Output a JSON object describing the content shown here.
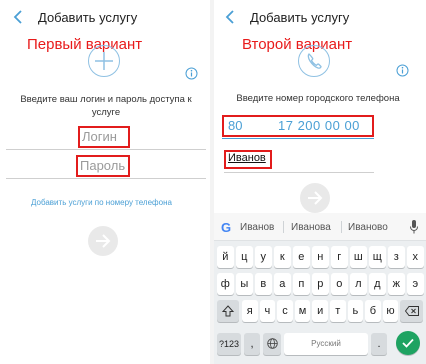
{
  "left": {
    "title": "Добавить услугу",
    "variant_label": "Первый вариант",
    "prompt": "Введите ваш логин и пароль доступа к услуге",
    "login_placeholder": "Логин",
    "password_placeholder": "Пароль",
    "link": "Добавить услуги по номеру телефона"
  },
  "right": {
    "title": "Добавить услугу",
    "variant_label": "Второй вариант",
    "prompt": "Введите номер городского телефона",
    "phone_code": "80",
    "phone_number": "17 200 00 00",
    "name_value": "Иванов"
  },
  "keyboard": {
    "suggestions": [
      "Иванов",
      "Иванова",
      "Иваново"
    ],
    "row1": [
      "й",
      "ц",
      "у",
      "к",
      "е",
      "н",
      "г",
      "ш",
      "щ",
      "з",
      "х"
    ],
    "row2": [
      "ф",
      "ы",
      "в",
      "а",
      "п",
      "р",
      "о",
      "л",
      "д",
      "ж",
      "э"
    ],
    "row3": [
      "я",
      "ч",
      "с",
      "м",
      "и",
      "т",
      "ь",
      "б",
      "ю"
    ],
    "symbols_label": "?123",
    "comma_label": ",",
    "space_label": "Русский",
    "period_label": "."
  },
  "colors": {
    "accent": "#4a9fd5",
    "highlight": "#e21c1c",
    "enter": "#1ea362"
  },
  "icons": [
    "back-arrow-icon",
    "plus-circle-icon",
    "phone-circle-icon",
    "info-icon",
    "arrow-right-icon",
    "google-icon",
    "mic-icon",
    "shift-icon",
    "backspace-icon",
    "globe-icon",
    "emoji-icon",
    "check-icon"
  ]
}
